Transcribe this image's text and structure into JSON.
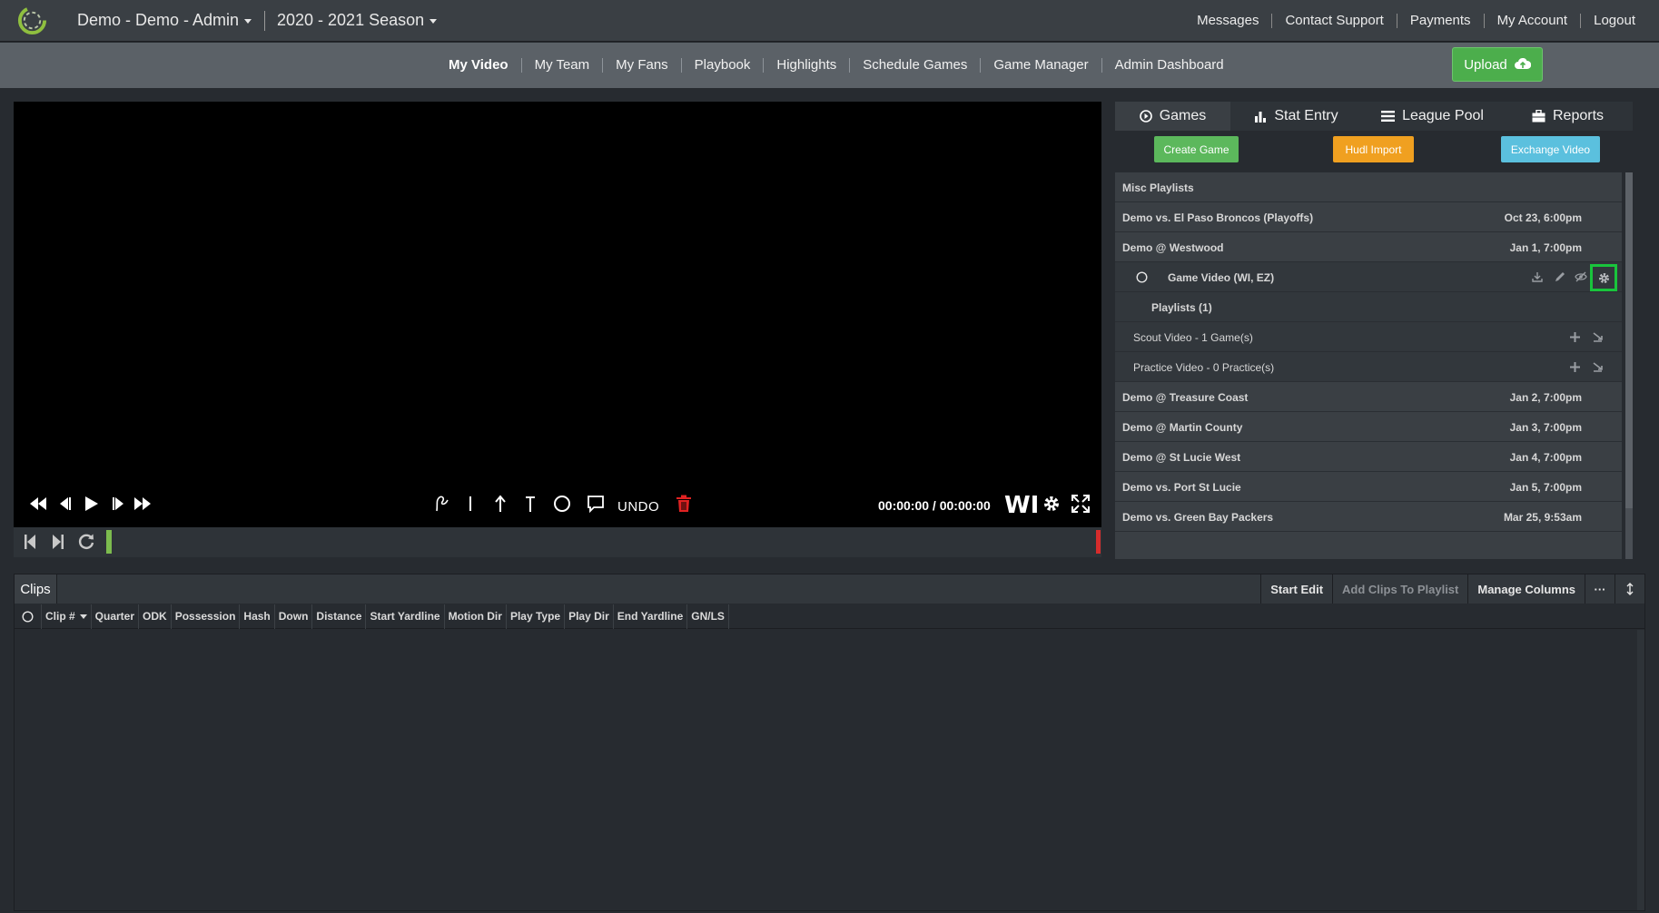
{
  "topbar": {
    "team_label": "Demo - Demo - Admin",
    "season_label": "2020 - 2021 Season",
    "links": [
      "Messages",
      "Contact Support",
      "Payments",
      "My Account",
      "Logout"
    ]
  },
  "nav": {
    "items": [
      "My Video",
      "My Team",
      "My Fans",
      "Playbook",
      "Highlights",
      "Schedule Games",
      "Game Manager",
      "Admin Dashboard"
    ],
    "active": "My Video",
    "upload_label": "Upload"
  },
  "player": {
    "undo_label": "UNDO",
    "timecode": "00:00:00 / 00:00:00",
    "wi_label": "WI"
  },
  "right_panel": {
    "tabs": [
      "Games",
      "Stat Entry",
      "League Pool",
      "Reports"
    ],
    "active_tab": "Games",
    "buttons": {
      "create_game": "Create Game",
      "hudl_import": "Hudl Import",
      "exchange_video": "Exchange Video"
    },
    "colors": {
      "create_game": "#5cb85c",
      "hudl_import": "#f0a020",
      "exchange_video": "#5bc0de",
      "highlight": "#19c43c"
    },
    "misc_playlists": "Misc Playlists",
    "games": [
      {
        "title": "Demo vs. El Paso Broncos (Playoffs)",
        "date": "Oct 23, 6:00pm"
      },
      {
        "title": "Demo @ Westwood",
        "date": "Jan 1, 7:00pm"
      }
    ],
    "game_video": "Game Video (WI, EZ)",
    "playlists_label": "Playlists (1)",
    "scout_video": "Scout Video - 1 Game(s)",
    "practice_video": "Practice Video - 0 Practice(s)",
    "more_games": [
      {
        "title": "Demo @ Treasure Coast",
        "date": "Jan 2, 7:00pm"
      },
      {
        "title": "Demo @ Martin County",
        "date": "Jan 3, 7:00pm"
      },
      {
        "title": "Demo @ St Lucie West",
        "date": "Jan 4, 7:00pm"
      },
      {
        "title": "Demo vs. Port St Lucie",
        "date": "Jan 5, 7:00pm"
      },
      {
        "title": "Demo vs. Green Bay Packers",
        "date": "Mar 25, 9:53am"
      }
    ]
  },
  "clips": {
    "tab_label": "Clips",
    "actions": {
      "start_edit": "Start Edit",
      "add_to_playlist": "Add Clips To Playlist",
      "manage_columns": "Manage Columns",
      "more": "···"
    },
    "columns": [
      "Clip #",
      "Quarter",
      "ODK",
      "Possession",
      "Hash",
      "Down",
      "Distance",
      "Start Yardline",
      "Motion Dir",
      "Play Type",
      "Play Dir",
      "End Yardline",
      "GN/LS"
    ]
  }
}
